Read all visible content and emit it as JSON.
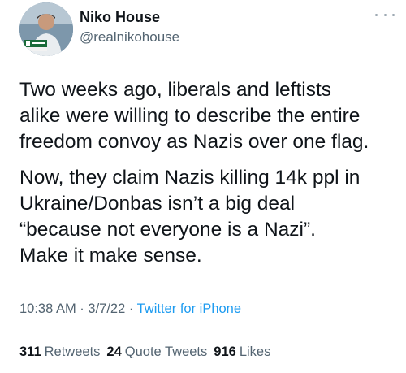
{
  "author": {
    "name": "Niko House",
    "handle": "@realnikohouse",
    "avatar_icon": "profile-photo"
  },
  "tweet": {
    "paragraphs": [
      "Two weeks ago, liberals and leftists\nalike were willing to describe the entire\nfreedom convoy as Nazis over one flag.",
      "Now, they claim Nazis killing 14k ppl in\nUkraine/Donbas isn’t a big deal\n“because not everyone is a Nazi”.\nMake it make sense."
    ],
    "time": "10:38 AM",
    "date": "3/7/22",
    "separator": " · ",
    "source": "Twitter for iPhone"
  },
  "stats": {
    "retweets_count": "311",
    "retweets_label": "Retweets",
    "quotes_count": "24",
    "quotes_label": "Quote Tweets",
    "likes_count": "916",
    "likes_label": "Likes"
  },
  "colors": {
    "text": "#0f1419",
    "secondary": "#536471",
    "link": "#1d9bf0"
  }
}
